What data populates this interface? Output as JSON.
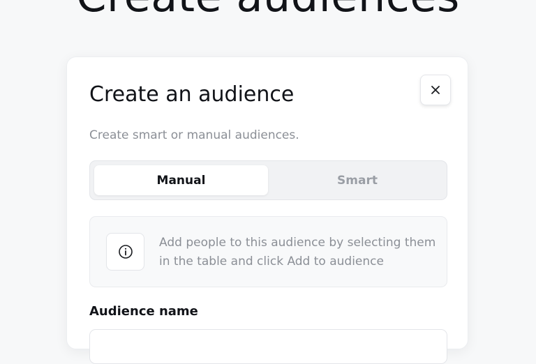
{
  "background": {
    "title": "Create audiences"
  },
  "modal": {
    "title": "Create an audience",
    "subtitle": "Create smart or manual audiences.",
    "close_icon": "close-icon",
    "tabs": [
      {
        "label": "Manual",
        "selected": true
      },
      {
        "label": "Smart",
        "selected": false
      }
    ],
    "info": {
      "icon": "info-icon",
      "text": "Add people to this audience by selecting them in the table and click Add to audience"
    },
    "audience_name": {
      "label": "Audience name",
      "value": "",
      "placeholder": ""
    }
  },
  "colors": {
    "page_background": "#f7f8f9",
    "text_primary": "#111318",
    "text_muted": "#8b8f96",
    "tab_inactive": "#9a9ea5"
  }
}
